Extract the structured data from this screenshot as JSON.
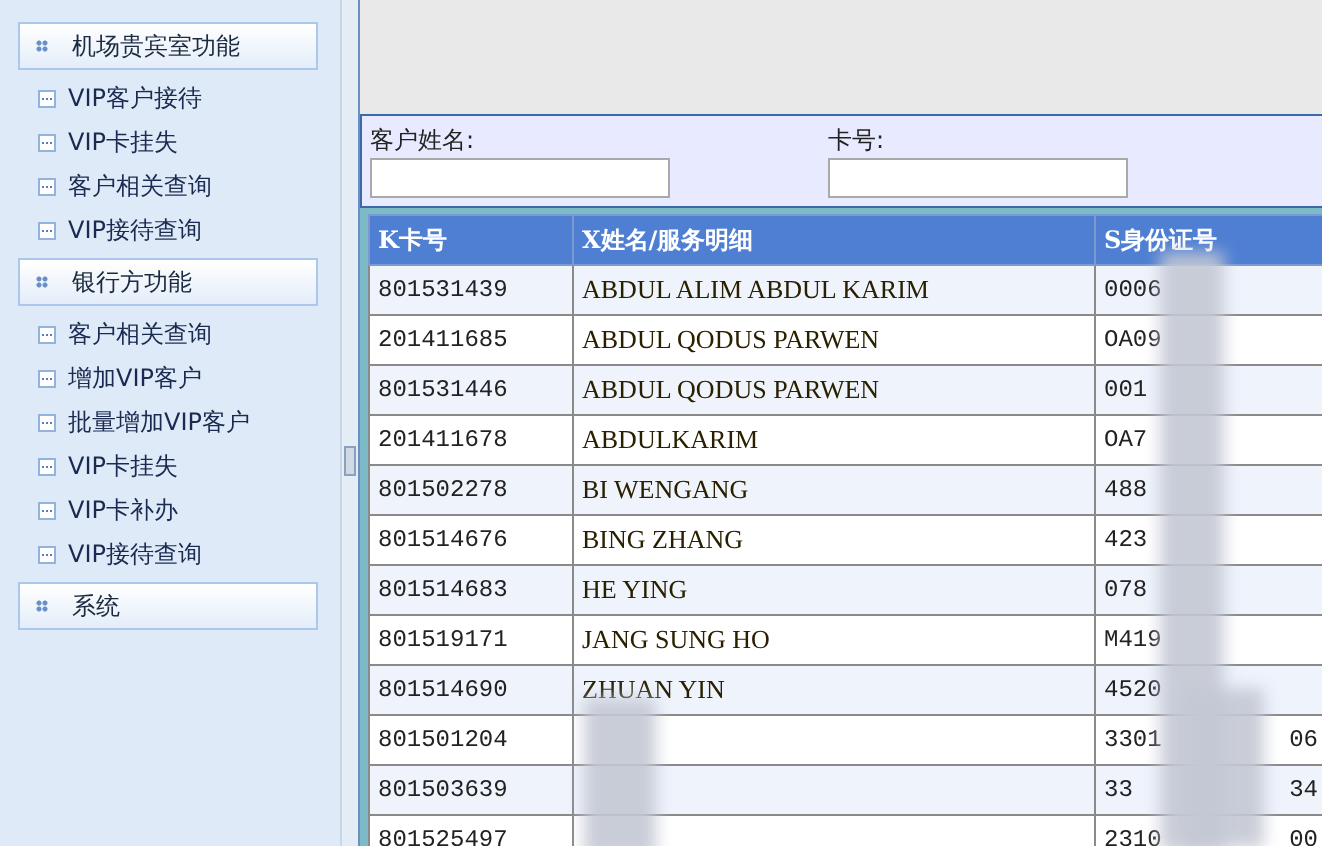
{
  "sidebar": {
    "groups": [
      {
        "title": "机场贵宾室功能",
        "items": [
          "VIP客户接待",
          "VIP卡挂失",
          "客户相关查询",
          "VIP接待查询"
        ]
      },
      {
        "title": "银行方功能",
        "items": [
          "客户相关查询",
          "增加VIP客户",
          "批量增加VIP客户",
          "VIP卡挂失",
          "VIP卡补办",
          "VIP接待查询"
        ]
      },
      {
        "title": "系统"
      }
    ]
  },
  "search": {
    "fields": [
      {
        "label": "客户姓名:"
      },
      {
        "label": "卡号:"
      }
    ]
  },
  "table": {
    "columns": [
      "K卡号",
      "X姓名/服务明细",
      "S身份证号"
    ],
    "rows": [
      {
        "card": "801531439",
        "name": "ABDUL ALIM ABDUL KARIM",
        "id": "0006"
      },
      {
        "card": "201411685",
        "name": "ABDUL QODUS PARWEN",
        "id": "OA09"
      },
      {
        "card": "801531446",
        "name": "ABDUL QODUS PARWEN",
        "id": "001"
      },
      {
        "card": "201411678",
        "name": "ABDULKARIM",
        "id": "OA7"
      },
      {
        "card": "801502278",
        "name": "BI WENGANG",
        "id": "488"
      },
      {
        "card": "801514676",
        "name": "BING ZHANG",
        "id": "423"
      },
      {
        "card": "801514683",
        "name": "HE YING",
        "id": "078"
      },
      {
        "card": "801519171",
        "name": "JANG SUNG HO",
        "id": "M419"
      },
      {
        "card": "801514690",
        "name": "ZHUAN YIN",
        "id": "4520"
      },
      {
        "card": "801501204",
        "id": "3301",
        "id_end": "06"
      },
      {
        "card": "801503639",
        "id": "33",
        "id_end": "34"
      },
      {
        "card": "801525497",
        "id": "2310",
        "id_end": "00"
      }
    ]
  }
}
